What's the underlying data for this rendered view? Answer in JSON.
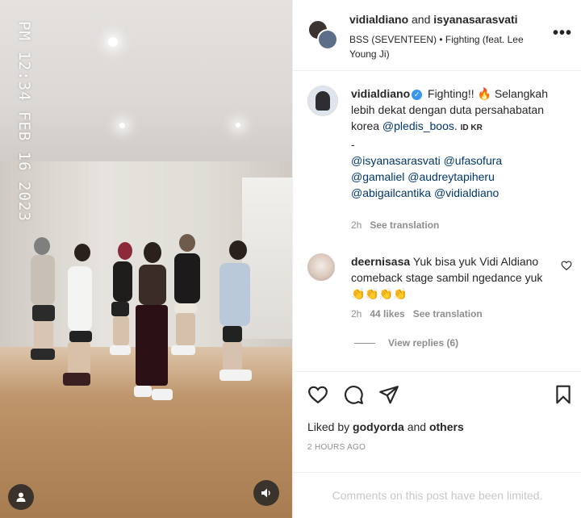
{
  "video": {
    "timestamp_line1": "PM 12:34",
    "timestamp_line2": "FEB 16 2023",
    "user_tag_icon": "user-icon",
    "volume_icon": "speaker-icon"
  },
  "header": {
    "user1": "vidialdiano",
    "joiner": " and ",
    "user2": "isyanasarasvati",
    "audio": "BSS (SEVENTEEN) • Fighting (feat. Lee Young Ji)",
    "more_icon": "more-options-icon"
  },
  "caption": {
    "username": "vidialdiano",
    "text_before": "Fighting!! 🔥 Selangkah lebih dekat dengan duta persahabatan korea ",
    "mention_pledis": "@pledis_boos",
    "text_after": ". ",
    "flag_text": "ID KR",
    "dash": "-",
    "mentions": [
      "@isyanasarasvati",
      "@ufasofura",
      "@gamaliel",
      "@audreytapiheru",
      "@abigailcantika",
      "@vidialdiano"
    ],
    "time": "2h",
    "see_translation": "See translation"
  },
  "comment": {
    "username": "deernisasa",
    "text": "Yuk bisa yuk Vidi Aldiano comeback stage sambil ngedance yuk👏👏👏👏",
    "time": "2h",
    "likes": "44 likes",
    "see_translation": "See translation",
    "view_replies": "View replies (6)"
  },
  "actions": {
    "liked_prefix": "Liked by ",
    "liked_user": "godyorda",
    "liked_and": " and ",
    "liked_others": "others",
    "time_ago": "2 HOURS AGO"
  },
  "footer": {
    "limited_text": "Comments on this post have been limited."
  }
}
